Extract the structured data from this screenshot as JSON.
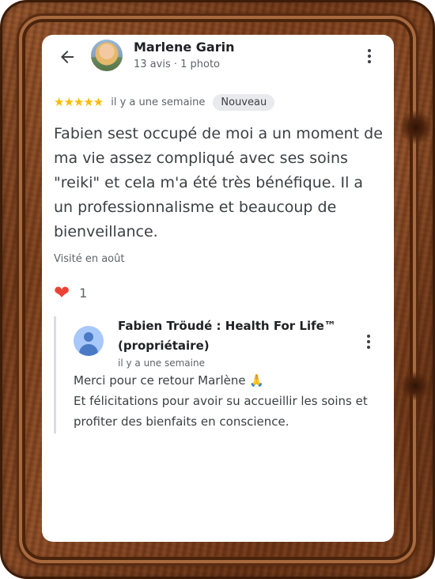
{
  "review": {
    "author_name": "Marlene Garin",
    "author_meta": "13 avis · 1 photo",
    "stars": "★★★★★",
    "rating": 5,
    "time": "il y a une semaine",
    "badge": "Nouveau",
    "text": "Fabien sest occupé de moi a un moment de ma vie assez compliqué avec ses soins \"reiki\" et cela m'a été très bénéfique. Il a un professionnalisme et beaucoup de bienveillance.",
    "visited": "Visité en août",
    "like_icon": "❤",
    "like_count": "1"
  },
  "reply": {
    "owner_name": "Fabien Tröudé : Health For Life™ (propriétaire)",
    "time": "il y a une semaine",
    "text": "Merci pour ce retour Marlène 🙏\nEt félicitations pour avoir su accueillir les soins et profiter des bienfaits en conscience."
  },
  "colors": {
    "star": "#fbbc04",
    "heart": "#ea4335",
    "frame_wood": "#7a3f1c",
    "badge_bg": "#e8eaed"
  },
  "icons": {
    "back": "arrow-left-icon",
    "more": "more-vertical-icon",
    "like": "heart-icon"
  }
}
